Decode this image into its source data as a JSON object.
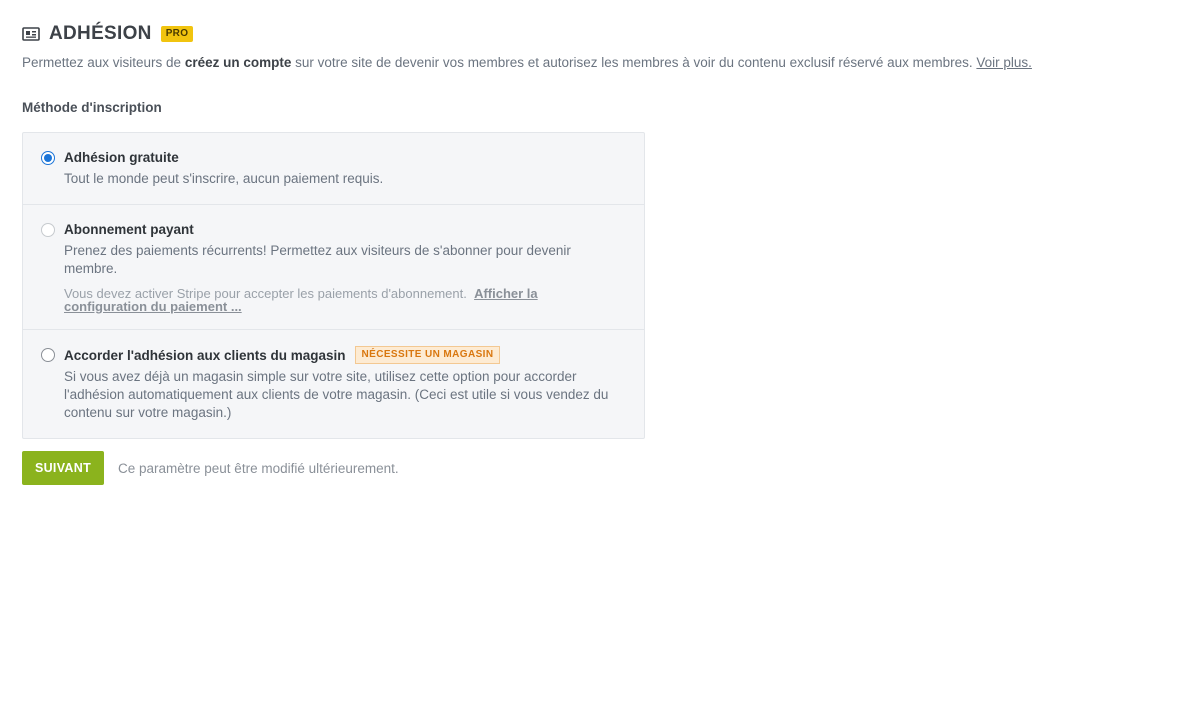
{
  "header": {
    "title": "ADHÉSION",
    "badge": "PRO",
    "icon": "membership-card-icon"
  },
  "description": {
    "text_before": "Permettez aux visiteurs de ",
    "bold": "créez un compte",
    "text_after": " sur votre site de devenir vos membres et autorisez les membres à voir du contenu exclusif réservé aux membres. ",
    "link": "Voir plus."
  },
  "section_label": "Méthode d'inscription",
  "options": [
    {
      "title": "Adhésion gratuite",
      "text": "Tout le monde peut s'inscrire, aucun paiement requis.",
      "selected": true
    },
    {
      "title": "Abonnement payant",
      "text": "Prenez des paiements récurrents! Permettez aux visiteurs de s'abonner pour devenir membre.",
      "note": "Vous devez activer Stripe pour accepter les paiements d'abonnement.",
      "note_link": "Afficher la configuration du paiement ...",
      "disabled": true
    },
    {
      "title": "Accorder l'adhésion aux clients du magasin",
      "badge": "NÉCESSITE UN MAGASIN",
      "text": "Si vous avez déjà un magasin simple sur votre site, utilisez cette option pour accorder l'adhésion automatiquement aux clients de votre magasin. (Ceci est utile si vous vendez du contenu sur votre magasin.)"
    }
  ],
  "footer": {
    "next_label": "SUIVANT",
    "note": "Ce paramètre peut être modifié ultérieurement."
  },
  "colors": {
    "accent_blue": "#1c75d8",
    "button_green": "#8bb31d",
    "pro_badge": "#f1c40f",
    "store_badge_text": "#d9770f"
  }
}
